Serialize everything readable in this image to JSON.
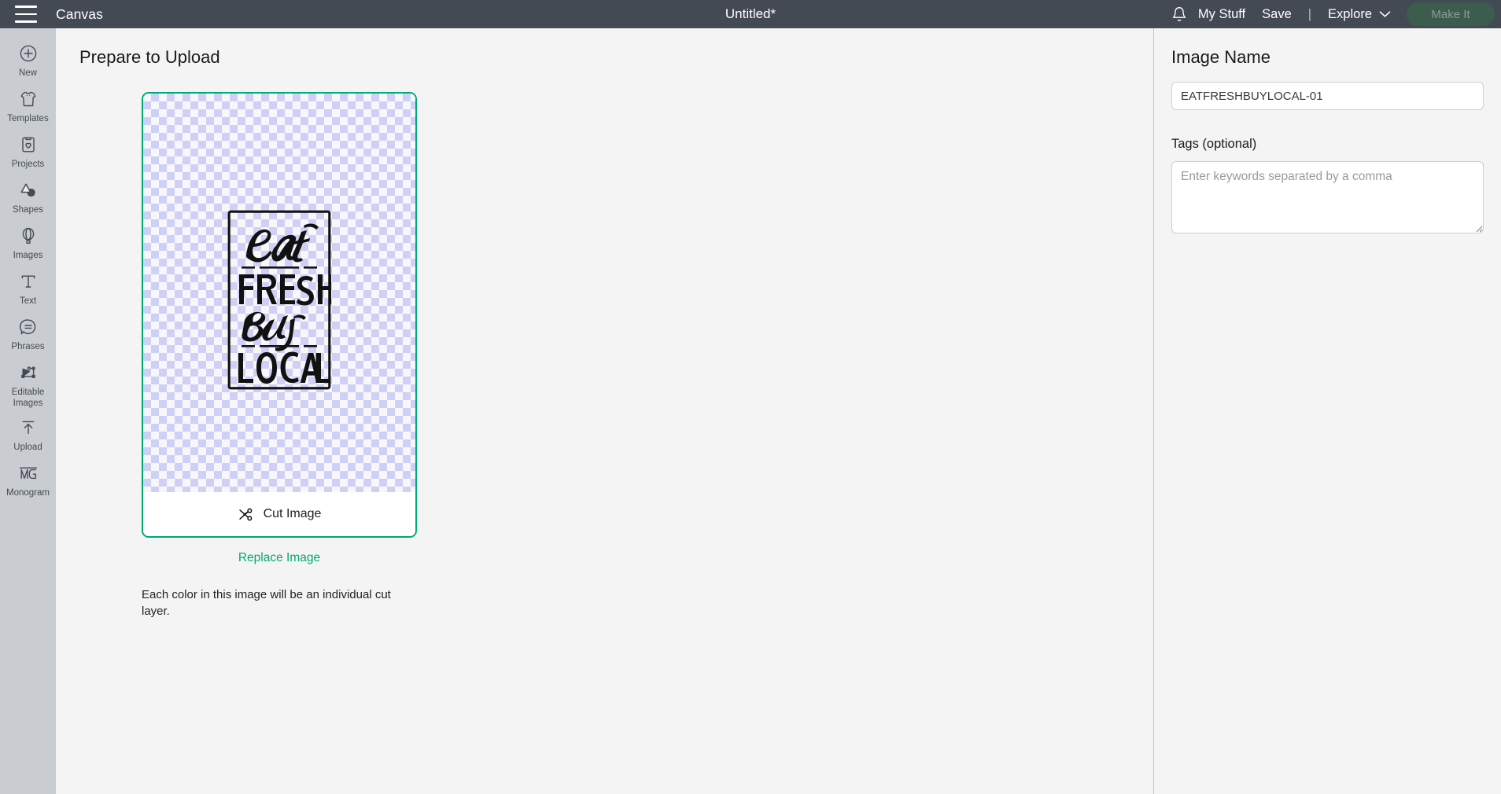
{
  "topbar": {
    "menu_icon": "hamburger-icon",
    "canvas_label": "Canvas",
    "project_title": "Untitled*",
    "notifications_icon": "bell-icon",
    "my_stuff_label": "My Stuff",
    "save_label": "Save",
    "separator": "|",
    "explore_label": "Explore",
    "explore_chevron_icon": "chevron-down-icon",
    "make_it_label": "Make It",
    "background_color": "#434a54",
    "make_it_color": "#3c5c4e"
  },
  "sidebar": {
    "background_color": "#c9ccd1",
    "items": [
      {
        "label": "New",
        "icon": "plus-circle-icon"
      },
      {
        "label": "Templates",
        "icon": "tshirt-icon"
      },
      {
        "label": "Projects",
        "icon": "clipboard-heart-icon"
      },
      {
        "label": "Shapes",
        "icon": "shapes-icon"
      },
      {
        "label": "Images",
        "icon": "hot-air-balloon-icon"
      },
      {
        "label": "Text",
        "icon": "text-t-icon"
      },
      {
        "label": "Phrases",
        "icon": "speech-bubble-icon"
      },
      {
        "label": "Editable Images",
        "icon": "editable-nodes-icon"
      },
      {
        "label": "Upload",
        "icon": "upload-arrow-icon"
      },
      {
        "label": "Monogram",
        "icon": "monogram-mg-icon"
      }
    ]
  },
  "main": {
    "page_title": "Prepare to Upload",
    "card": {
      "border_color": "#00a878",
      "cut_image_label": "Cut Image",
      "cut_icon": "scissors-icon",
      "checker_color": "#ced0f5"
    },
    "replace_image_label": "Replace Image",
    "description": "Each color in this image will be an individual cut layer.",
    "artwork": {
      "line1": "Eat",
      "line2": "FRESH",
      "line3": "Buy",
      "line4": "LOCAL"
    }
  },
  "right_panel": {
    "image_name_heading": "Image Name",
    "image_name_value": "EATFRESHBUYLOCAL-01",
    "tags_label": "Tags (optional)",
    "tags_value": "",
    "tags_placeholder": "Enter keywords separated by a comma"
  }
}
